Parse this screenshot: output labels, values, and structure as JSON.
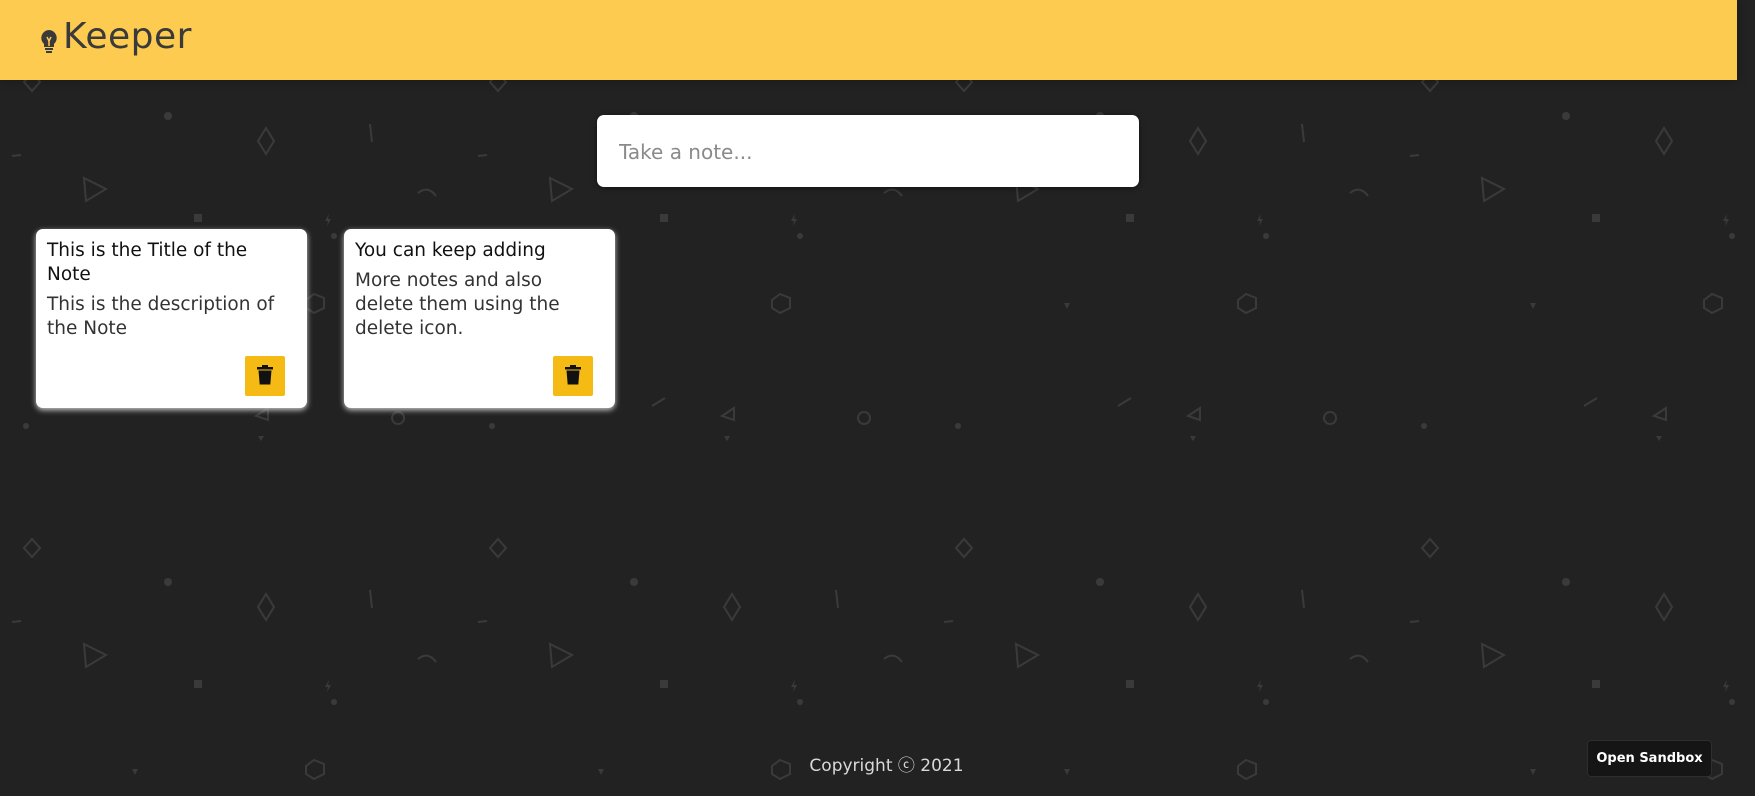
{
  "header": {
    "app_title": "Keeper",
    "logo_icon": "lightbulb-icon",
    "background_color": "#fdcb50"
  },
  "create_note": {
    "placeholder": "Take a note..."
  },
  "notes": [
    {
      "title": "This is the Title of the Note",
      "content": "This is the description of the Note",
      "delete_icon": "trash-icon"
    },
    {
      "title": "You can keep adding",
      "content": "More notes and also delete them using the delete icon.",
      "delete_icon": "trash-icon"
    }
  ],
  "footer": {
    "copyright": "Copyright ⓒ 2021"
  },
  "sandbox": {
    "label": "Open Sandbox"
  },
  "colors": {
    "accent": "#f5ba13",
    "page_background": "#222222"
  }
}
